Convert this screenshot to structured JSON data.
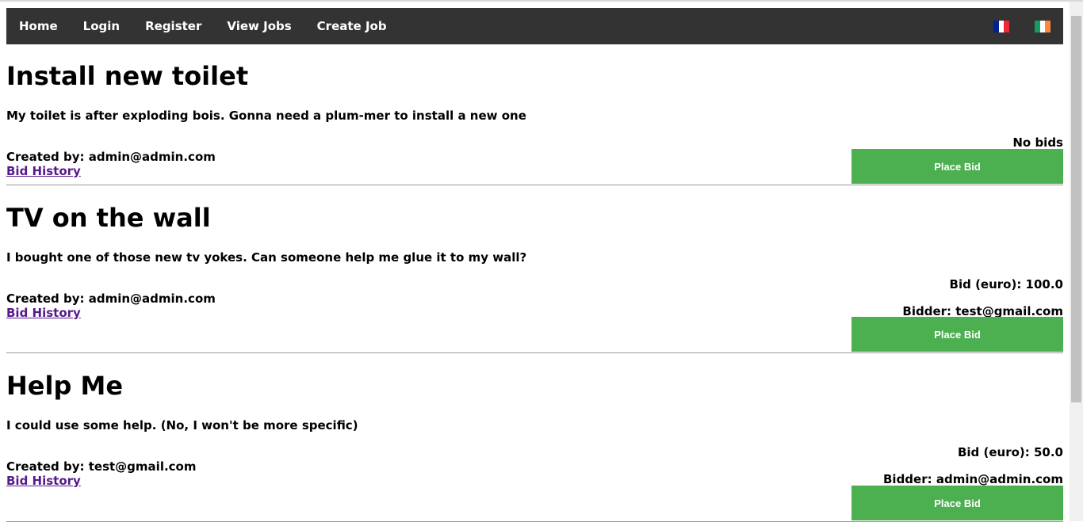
{
  "nav": {
    "items": [
      "Home",
      "Login",
      "Register",
      "View Jobs",
      "Create Job"
    ]
  },
  "jobs": [
    {
      "title": "Install new toilet",
      "description": "My toilet is after exploding bois. Gonna need a plum-mer to install a new one",
      "created_by": "Created by: admin@admin.com",
      "bid_history": "Bid History",
      "status": "No bids",
      "bidder": "",
      "button": "Place Bid"
    },
    {
      "title": "TV on the wall",
      "description": "I bought one of those new tv yokes. Can someone help me glue it to my wall?",
      "created_by": "Created by: admin@admin.com",
      "bid_history": "Bid History",
      "status": "Bid (euro): 100.0",
      "bidder": "Bidder: test@gmail.com",
      "button": "Place Bid"
    },
    {
      "title": "Help Me",
      "description": "I could use some help. (No, I won't be more specific)",
      "created_by": "Created by: test@gmail.com",
      "bid_history": "Bid History",
      "status": "Bid (euro): 50.0",
      "bidder": "Bidder: admin@admin.com",
      "button": "Place Bid"
    }
  ],
  "colors": {
    "navbar": "#333333",
    "button": "#4caf50",
    "link": "#551a8b"
  }
}
